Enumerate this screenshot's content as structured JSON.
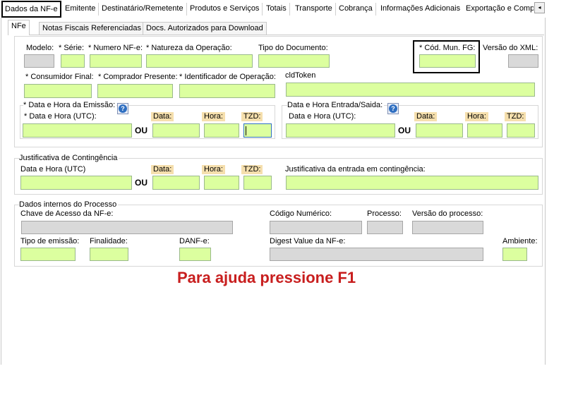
{
  "top_tabs": {
    "active": "Dados da NF-e",
    "items": [
      "Emitente",
      "Destinatário/Remetente",
      "Produtos e Serviços",
      "Totais",
      "Transporte",
      "Cobrança",
      "Informações Adicionais",
      "Exportação e Compr"
    ],
    "scroll_arrow": "◂"
  },
  "sub_tabs": [
    "NFe",
    "Notas Fiscais Referenciadas",
    "Docs. Autorizados para Download"
  ],
  "nfe": {
    "modelo": "Modelo:",
    "serie": "* Série:",
    "numero": "* Numero NF-e:",
    "natureza": "* Natureza da Operação:",
    "tipo_doc": "Tipo do Documento:",
    "cod_mun": "* Cód. Mun. FG:",
    "versao_xml": "Versão do XML:",
    "consumidor": "* Consumidor Final:",
    "comprador": "* Comprador Presente:",
    "identificador": "* Identificador de Operação:",
    "cidtoken": "cldToken"
  },
  "emissao": {
    "group": "* Data e Hora da Emissão:",
    "utc": "* Data e Hora (UTC):",
    "data": "Data:",
    "hora": "Hora:",
    "tzd": "TZD:",
    "ou": "OU",
    "help": "?"
  },
  "entrada": {
    "group": "Data e Hora Entrada/Saida:",
    "utc": "Data e Hora (UTC):",
    "data": "Data:",
    "hora": "Hora:",
    "tzd": "TZD:",
    "ou": "OU",
    "help": "?"
  },
  "contingencia": {
    "group": "Justificativa de Contingência",
    "utc": "Data e Hora (UTC)",
    "data": "Data:",
    "hora": "Hora:",
    "tzd": "TZD:",
    "ou": "OU",
    "justificativa": "Justificativa da entrada em contingência:"
  },
  "interno": {
    "group": "Dados internos do Processo",
    "chave": "Chave de Acesso da NF-e:",
    "codigo": "Código Numérico:",
    "processo": "Processo:",
    "versao_processo": "Versão do processo:",
    "tipo_emissao": "Tipo de emissão:",
    "finalidade": "Finalidade:",
    "danfe": "DANF-e:",
    "digest": "Digest Value da NF-e:",
    "ambiente": "Ambiente:"
  },
  "footer": "Para ajuda pressione F1",
  "colors": {
    "input_fill": "#dcff9f",
    "readonly_fill": "#d9d9d9",
    "tag_fill": "#f5dfad",
    "footer_text": "#c81e1e"
  }
}
